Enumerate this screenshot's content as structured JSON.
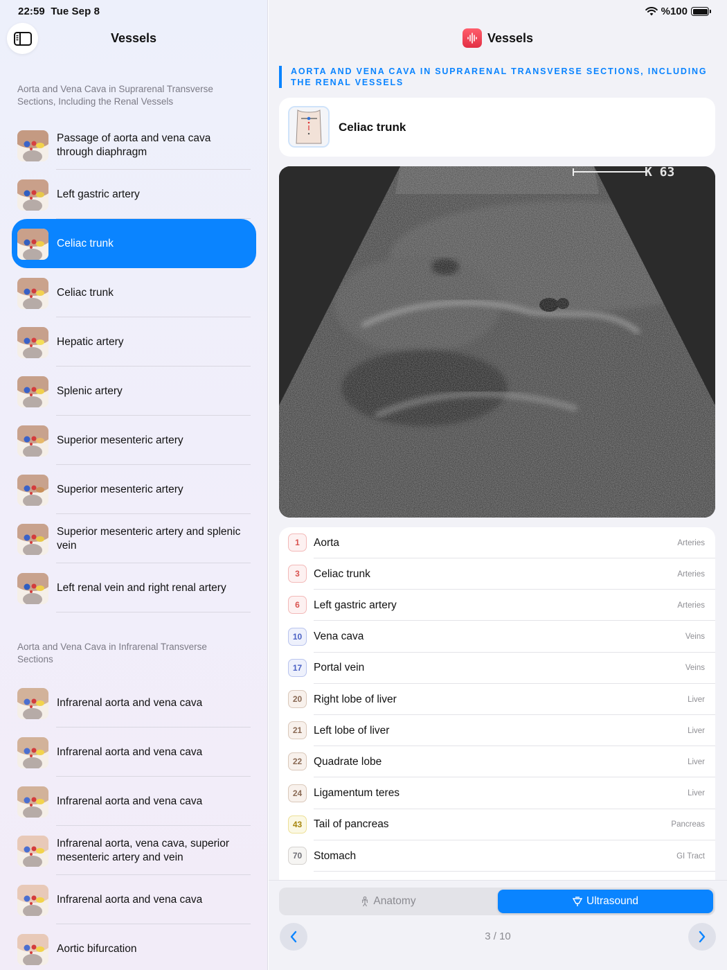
{
  "status": {
    "time": "22:59",
    "date": "Tue Sep 8",
    "battery": "%100",
    "battery_level": 1.0
  },
  "sidebar": {
    "title": "Vessels",
    "sections": [
      {
        "header": "Aorta and Vena Cava in Suprarenal Transverse Sections, Including the Renal Vessels"
      },
      {
        "header": "Aorta and Vena Cava in Infrarenal Transverse Sections"
      }
    ],
    "items": [
      {
        "label": "Passage of aorta and vena cava through diaphragm"
      },
      {
        "label": "Left gastric artery"
      },
      {
        "label": "Celiac trunk",
        "selected": true
      },
      {
        "label": "Celiac trunk"
      },
      {
        "label": "Hepatic artery"
      },
      {
        "label": "Splenic artery"
      },
      {
        "label": "Superior mesenteric artery"
      },
      {
        "label": "Superior mesenteric artery"
      },
      {
        "label": "Superior mesenteric artery and splenic vein"
      },
      {
        "label": "Left renal vein and right renal artery"
      },
      {
        "label": "Infrarenal aorta and vena cava"
      },
      {
        "label": "Infrarenal aorta and vena cava"
      },
      {
        "label": "Infrarenal aorta and vena cava"
      },
      {
        "label": "Infrarenal aorta, vena cava, superior mesenteric artery and vein"
      },
      {
        "label": "Infrarenal aorta and vena cava"
      },
      {
        "label": "Aortic bifurcation"
      }
    ]
  },
  "detail": {
    "nav_title": "Vessels",
    "section_title": "AORTA AND VENA CAVA IN SUPRARENAL TRANSVERSE SECTIONS, INCLUDING THE RENAL VESSELS",
    "topic_title": "Celiac trunk",
    "image_marker": "K 63",
    "structures": [
      {
        "num": "1",
        "name": "Aorta",
        "category": "Arteries",
        "color": "red"
      },
      {
        "num": "3",
        "name": "Celiac trunk",
        "category": "Arteries",
        "color": "red"
      },
      {
        "num": "6",
        "name": "Left gastric artery",
        "category": "Arteries",
        "color": "red"
      },
      {
        "num": "10",
        "name": "Vena cava",
        "category": "Veins",
        "color": "blue"
      },
      {
        "num": "17",
        "name": "Portal vein",
        "category": "Veins",
        "color": "blue"
      },
      {
        "num": "20",
        "name": "Right lobe of liver",
        "category": "Liver",
        "color": "brown"
      },
      {
        "num": "21",
        "name": "Left lobe of liver",
        "category": "Liver",
        "color": "brown"
      },
      {
        "num": "22",
        "name": "Quadrate lobe",
        "category": "Liver",
        "color": "brown"
      },
      {
        "num": "24",
        "name": "Ligamentum teres",
        "category": "Liver",
        "color": "brown"
      },
      {
        "num": "43",
        "name": "Tail of pancreas",
        "category": "Pancreas",
        "color": "yellow"
      },
      {
        "num": "70",
        "name": "Stomach",
        "category": "GI Tract",
        "color": "gray"
      }
    ],
    "tabs": {
      "anatomy": "Anatomy",
      "ultrasound": "Ultrasound",
      "selected": "ultrasound"
    },
    "pager": {
      "current": 3,
      "total": 10,
      "label": "3 / 10"
    }
  },
  "colors": {
    "accent": "#0a84ff",
    "arteries": "#d9534f",
    "veins": "#4c62c4",
    "liver": "#8a6a55",
    "pancreas": "#a7860e"
  }
}
